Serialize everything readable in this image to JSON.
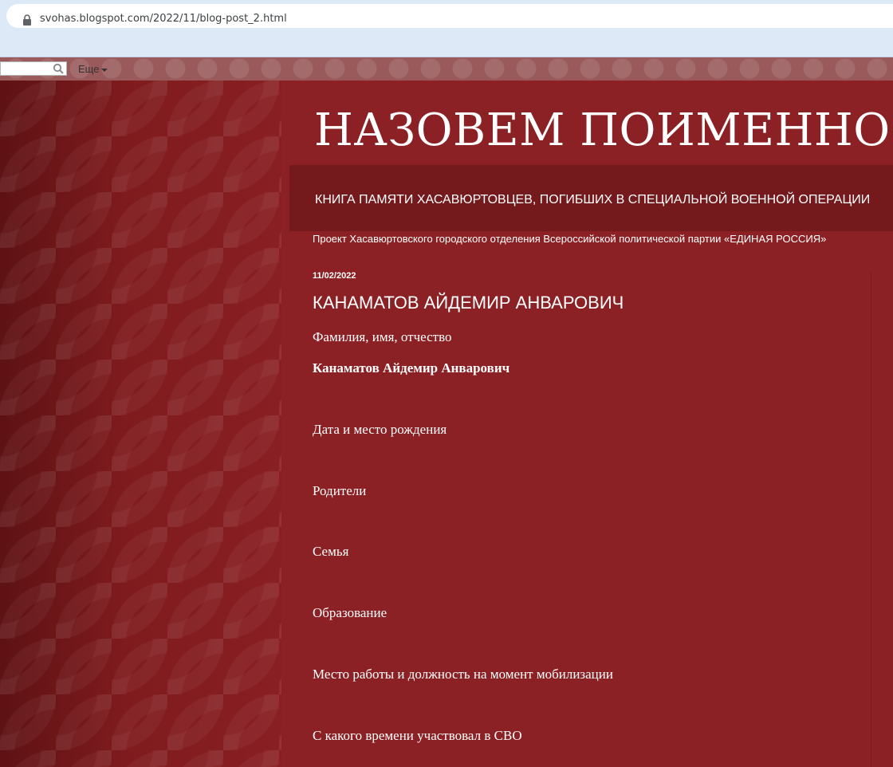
{
  "browser": {
    "url": "svohas.blogspot.com/2022/11/blog-post_2.html"
  },
  "navbar": {
    "search_placeholder": "",
    "more_label": "Еще"
  },
  "header": {
    "title": "НАЗОВЕМ ПОИМЕННО",
    "subtitle": "КНИГА ПАМЯТИ ХАСАВЮРТОВЦЕВ, ПОГИБШИХ В СПЕЦИАЛЬНОЙ ВОЕННОЙ ОПЕРАЦИИ",
    "project": "Проект Хасавюртовского городского отделения Всероссийской политической партии «ЕДИНАЯ РОССИЯ»"
  },
  "post": {
    "date": "11/02/2022",
    "title": "КАНАМАТОВ АЙДЕМИР АНВАРОВИЧ",
    "fields": [
      {
        "label": "Фамилия, имя, отчество"
      },
      {
        "value": "Канаматов Айдемир Анварович"
      },
      {
        "label": "Дата и место рождения"
      },
      {
        "label": "Родители"
      },
      {
        "label": "Семья"
      },
      {
        "label": "Образование"
      },
      {
        "label": "Место работы и должность на момент мобилизации"
      },
      {
        "label": "С какого времени участвовал в СВО"
      }
    ]
  },
  "colors": {
    "main_background": "#8b2124",
    "header_band": "#74191c",
    "side_pattern": "#7e1a1d",
    "text": "#ffffff"
  }
}
